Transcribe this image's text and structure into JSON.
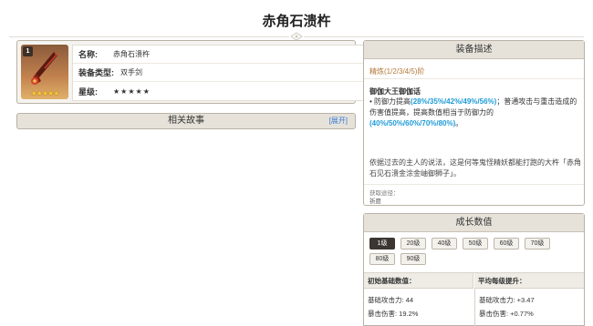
{
  "page": {
    "title": "赤角石溃杵"
  },
  "weapon": {
    "name_label": "名称:",
    "name": "赤角石溃杵",
    "type_label": "装备类型:",
    "type": "双手剑",
    "rarity_label": "星级:",
    "stars": "★★★★★",
    "level_badge": "1",
    "thumb_stars": "★★★★★"
  },
  "story": {
    "title": "相关故事",
    "expand": "[展开]"
  },
  "description": {
    "header": "装备描述",
    "refinement": "精炼(1/2/3/4/5)阶",
    "passive_name": "御伽大王御伽话",
    "passive_pre": "• 防御力提高",
    "passive_val1": "(28%/35%/42%/49%/56%)",
    "passive_mid": "；普通攻击与重击造成的伤害值提高，提高数值相当于防御力的",
    "passive_val2": "(40%/50%/60%/70%/80%)",
    "passive_end": "。",
    "lore": "依据过去的主人的说法，这是何等鬼怪精妖都能打跑的大杵「赤角石见石溃金涂金岫御狮子」。",
    "source_label": "获取途径：",
    "source": "祈愿"
  },
  "growth": {
    "header": "成长数值",
    "levels": [
      "1级",
      "20级",
      "40级",
      "50级",
      "60级",
      "70级",
      "80级",
      "90级"
    ],
    "active_level": "1级",
    "base_head": "初始基础数值：",
    "growth_head": "平均每级提升：",
    "base_atk": "基础攻击力: 44",
    "base_crit": "暴击伤害: 19.2%",
    "grow_atk": "基础攻击力: +3.47",
    "grow_crit": "暴击伤害: +0.77%"
  },
  "colors": {
    "accent_blue": "#1e9bd7",
    "refine_orange": "#b5793a",
    "star_gold": "#f0a81a",
    "header_bg": "#e6e2da"
  }
}
